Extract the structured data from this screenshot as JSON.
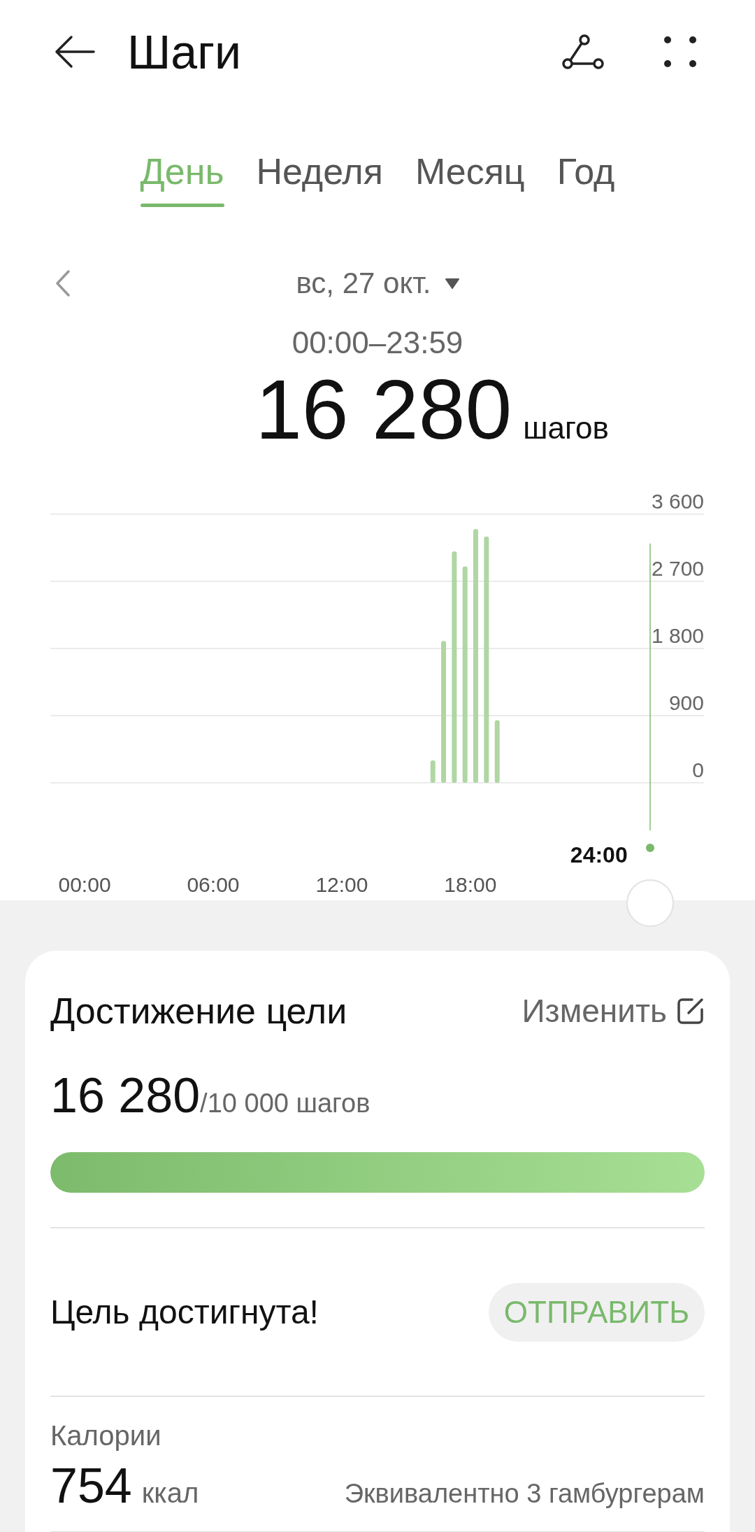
{
  "header": {
    "title": "Шаги"
  },
  "tabs": [
    {
      "label": "День",
      "selected": true
    },
    {
      "label": "Неделя",
      "selected": false
    },
    {
      "label": "Месяц",
      "selected": false
    },
    {
      "label": "Год",
      "selected": false
    }
  ],
  "date": {
    "label": "вс, 27 окт."
  },
  "time_range": "00:00–23:59",
  "total": {
    "value": "16 280",
    "unit": "шагов"
  },
  "chart_data": {
    "type": "bar",
    "grid": true,
    "x": [
      16.25,
      16.75,
      17.25,
      17.75,
      18.25,
      18.75,
      19.25
    ],
    "values": [
      300,
      1900,
      3100,
      2900,
      3400,
      3300,
      840
    ],
    "xlim": [
      -1.6,
      28.9
    ],
    "ylim": [
      0,
      3600
    ],
    "xticks": [
      {
        "value": 0,
        "label": "00:00"
      },
      {
        "value": 6,
        "label": "06:00"
      },
      {
        "value": 12,
        "label": "12:00"
      },
      {
        "value": 18,
        "label": "18:00"
      }
    ],
    "yticks": [
      {
        "value": 0,
        "label": "0"
      },
      {
        "value": 900,
        "label": "900"
      },
      {
        "value": 1800,
        "label": "1 800"
      },
      {
        "value": 2700,
        "label": "2 700"
      },
      {
        "value": 3600,
        "label": "3 600"
      }
    ]
  },
  "chart_cursor": {
    "label": "24:00"
  },
  "goal_card": {
    "title": "Достижение цели",
    "edit_label": "Изменить",
    "current": "16 280",
    "target": "/10 000 шагов",
    "level": 1,
    "status": "Цель достигнута!",
    "share_label": "ОТПРАВИТЬ"
  },
  "calories": {
    "label": "Калории",
    "value": "754",
    "unit": "ккал",
    "equivalent": "Эквивалентно 3 гамбургерам"
  }
}
